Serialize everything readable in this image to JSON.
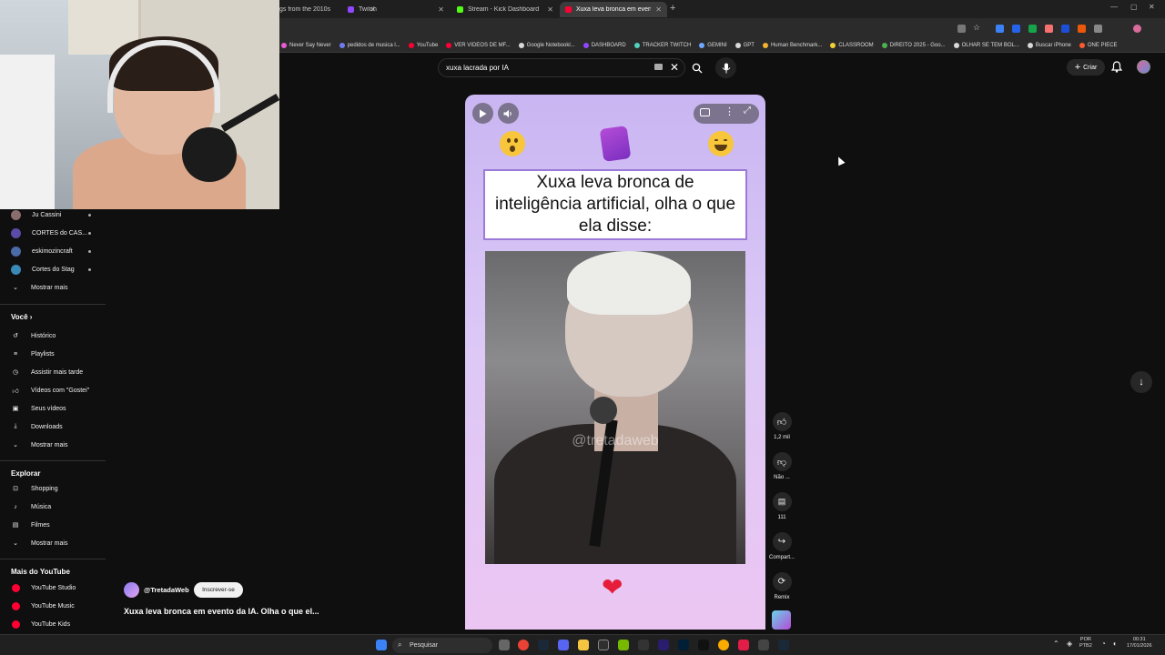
{
  "browser": {
    "tabs": [
      {
        "title": "gs from the 2010s",
        "color": "#ff3d3d"
      },
      {
        "title": "Twitch",
        "color": "#9146ff"
      },
      {
        "title": "Stream - Kick Dashboard",
        "color": "#53fc18"
      },
      {
        "title": "Xuxa leva bronca em evento da",
        "color": "#ff0033"
      }
    ],
    "new_tab": "+",
    "bookmarks": [
      {
        "label": "Never Say Never",
        "color": "#e85bd3"
      },
      {
        "label": "pedidos de musica l...",
        "color": "#6f7cf0"
      },
      {
        "label": "YouTube",
        "color": "#ff0033"
      },
      {
        "label": "VER VIDEOS DE MF...",
        "color": "#ff0033"
      },
      {
        "label": "Google Notebookl...",
        "color": "#d9d9d9"
      },
      {
        "label": "DASHBOARD",
        "color": "#9146ff"
      },
      {
        "label": "TRACKER TWITCH",
        "color": "#53d0c0"
      },
      {
        "label": "GEMINI",
        "color": "#6fa8ff"
      },
      {
        "label": "GPT",
        "color": "#d9d9d9"
      },
      {
        "label": "Human Benchmark...",
        "color": "#f2b233"
      },
      {
        "label": "CLASSROOM",
        "color": "#f2d233"
      },
      {
        "label": "DIREITO 2025 - Goo...",
        "color": "#4caf50"
      },
      {
        "label": "OLHAR SE TEM BOL...",
        "color": "#d9d9d9"
      },
      {
        "label": "Buscar iPhone",
        "color": "#d9d9d9"
      },
      {
        "label": "ONE PIECE",
        "color": "#ff5a2e"
      }
    ]
  },
  "youtube": {
    "search_value": "xuxa lacrada por IA",
    "create_label": "Criar",
    "sidebar": {
      "channels": [
        {
          "name": "Ju Cassini",
          "color": "#8a6d6d"
        },
        {
          "name": "CORTES do CAS...",
          "color": "#5b4aa8"
        },
        {
          "name": "eskimozincraft",
          "color": "#4a6aa8"
        },
        {
          "name": "Cortes do Stag",
          "color": "#3a8ab8"
        }
      ],
      "show_more_1": "Mostrar mais",
      "you_heading": "Você",
      "you_items": [
        "Histórico",
        "Playlists",
        "Assistir mais tarde",
        "Vídeos com \"Gostei\"",
        "Seus vídeos",
        "Downloads"
      ],
      "show_more_2": "Mostrar mais",
      "explore_heading": "Explorar",
      "explore_items": [
        "Shopping",
        "Música",
        "Filmes"
      ],
      "show_more_3": "Mostrar mais",
      "more_heading": "Mais do YouTube",
      "more_items": [
        "YouTube Studio",
        "YouTube Music",
        "YouTube Kids"
      ]
    },
    "short": {
      "headline": "Xuxa leva bronca de inteligência artificial, olha o que ela disse:",
      "watermark": "@tretadaweb",
      "heart": "❤"
    },
    "actions": {
      "like_count": "1,2 mil",
      "dislike_label": "Não ...",
      "comment_count": "111",
      "share_label": "Compart...",
      "remix_label": "Remix"
    },
    "channel": {
      "handle": "@TretadaWeb",
      "subscribe_label": "Inscrever-se",
      "video_title": "Xuxa leva bronca em evento da IA. Olha o que el..."
    }
  },
  "taskbar": {
    "search_label": "Pesquisar",
    "lang_line1": "POR",
    "lang_line2": "PTB2",
    "time": "00:31",
    "date": "17/01/2026"
  }
}
